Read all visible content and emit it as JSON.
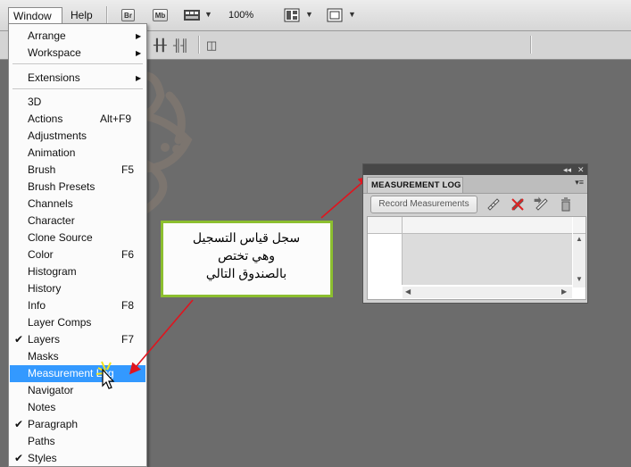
{
  "menubar": {
    "window_label": "Window",
    "help_label": "Help",
    "bridge_icon_text": "Br",
    "minibridge_icon_text": "Mb",
    "zoom_value": "100%"
  },
  "window_menu": {
    "items": [
      {
        "label": "Arrange",
        "submenu": true
      },
      {
        "label": "Workspace",
        "submenu": true
      },
      {
        "label": "Extensions",
        "submenu": true
      },
      {
        "label": "3D"
      },
      {
        "label": "Actions",
        "shortcut": "Alt+F9"
      },
      {
        "label": "Adjustments"
      },
      {
        "label": "Animation"
      },
      {
        "label": "Brush",
        "shortcut": "F5"
      },
      {
        "label": "Brush Presets"
      },
      {
        "label": "Channels"
      },
      {
        "label": "Character"
      },
      {
        "label": "Clone Source"
      },
      {
        "label": "Color",
        "shortcut": "F6"
      },
      {
        "label": "Histogram"
      },
      {
        "label": "History"
      },
      {
        "label": "Info",
        "shortcut": "F8"
      },
      {
        "label": "Layer Comps"
      },
      {
        "label": "Layers",
        "shortcut": "F7",
        "checked": true
      },
      {
        "label": "Masks"
      },
      {
        "label": "Measurement Log",
        "highlighted": true
      },
      {
        "label": "Navigator"
      },
      {
        "label": "Notes"
      },
      {
        "label": "Paragraph",
        "checked": true
      },
      {
        "label": "Paths"
      },
      {
        "label": "Styles",
        "checked": true
      }
    ],
    "highlight_color": "#3399ff"
  },
  "callout": {
    "lines": [
      "سجل قياس التسجيل",
      "وهي تختص",
      "بالصندوق التالي"
    ],
    "border_color": "#8cbf2f"
  },
  "panel": {
    "tab_label": "MEASUREMENT LOG",
    "record_button_label": "Record Measurements",
    "icons": [
      "select-all-measurements-icon",
      "deselect-measurements-icon",
      "export-measurements-icon",
      "delete-measurements-icon"
    ]
  },
  "arrow_color": "#e0141e"
}
